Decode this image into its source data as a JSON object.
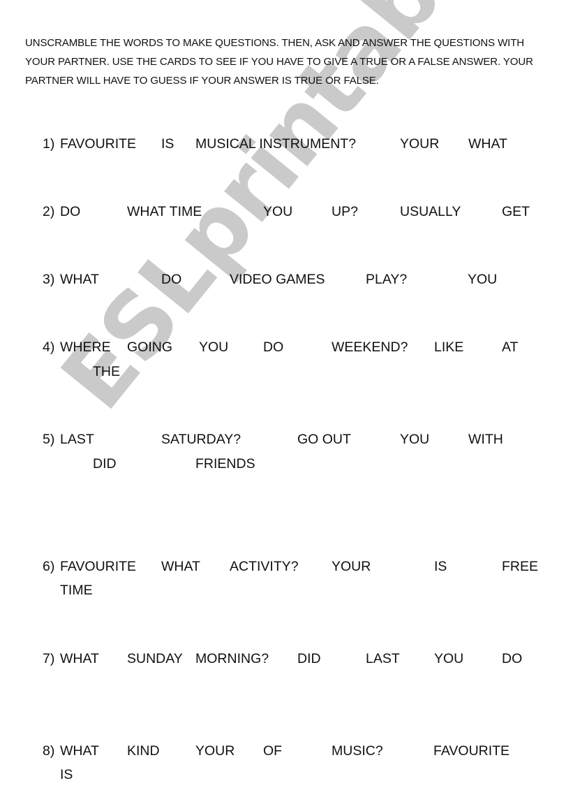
{
  "instructions": "UNSCRAMBLE THE WORDS TO MAKE QUESTIONS. THEN, ASK AND ANSWER THE QUESTIONS WITH YOUR PARTNER. USE THE CARDS TO SEE IF YOU HAVE TO GIVE A TRUE OR A FALSE ANSWER. YOUR PARTNER WILL HAVE TO GUESS IF YOUR ANSWER IS TRUE OR FALSE.",
  "watermark": "ESLprintables.com",
  "items": [
    {
      "number": "1)",
      "words": [
        "FAVOURITE",
        "IS",
        "MUSICAL INSTRUMENT?",
        "YOUR",
        "WHAT"
      ]
    },
    {
      "number": "2)",
      "words": [
        "DO",
        "WHAT TIME",
        "YOU",
        "UP?",
        "USUALLY",
        "GET"
      ]
    },
    {
      "number": "3)",
      "words": [
        "WHAT",
        "DO",
        "VIDEO GAMES",
        "PLAY?",
        "YOU"
      ]
    },
    {
      "number": "4)",
      "words": [
        "WHERE",
        "GOING",
        "YOU",
        "DO",
        "WEEKEND?",
        "LIKE",
        "AT",
        "THE"
      ]
    },
    {
      "number": "5)",
      "words": [
        "LAST",
        "SATURDAY?",
        "GO OUT",
        "YOU",
        "WITH",
        "DID",
        "FRIENDS"
      ]
    },
    {
      "number": "6)",
      "words": [
        "FAVOURITE",
        "WHAT",
        "ACTIVITY?",
        "YOUR",
        "IS",
        "FREE",
        "TIME"
      ]
    },
    {
      "number": "7)",
      "words": [
        "WHAT",
        "SUNDAY",
        "MORNING?",
        "DID",
        "LAST",
        "YOU",
        "DO"
      ]
    },
    {
      "number": "8)",
      "words": [
        "WHAT",
        "KIND",
        "YOUR",
        "OF",
        "MUSIC?",
        "FAVOURITE",
        "IS"
      ]
    }
  ]
}
